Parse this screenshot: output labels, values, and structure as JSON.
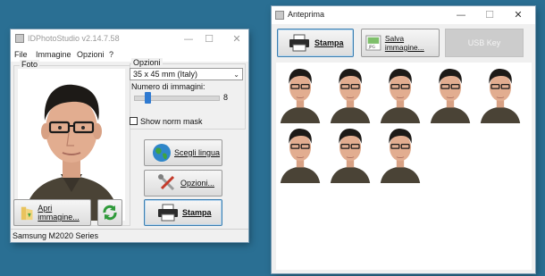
{
  "main_window": {
    "title": "IDPhotoStudio v2.14.7.58",
    "menu": [
      "File",
      "Immagine",
      "Opzioni",
      "?"
    ],
    "photo_group_label": "Foto",
    "options_group_label": "Opzioni",
    "size_select_value": "35 x 45 mm (Italy)",
    "count_label": "Numero di immagini:",
    "count_value": "8",
    "count_slider_fraction": 0.14,
    "norm_mask_label": "Show norm mask",
    "norm_mask_checked": false,
    "language_button": "Scegli lingua",
    "options_button": "Opzioni...",
    "open_image_button": "Apri immagine...",
    "print_button": "Stampa",
    "status_text": "Samsung M2020 Series"
  },
  "preview_window": {
    "title": "Anteprima",
    "print_button": "Stampa",
    "save_button": "Salva immagine...",
    "usb_button": "USB Key",
    "thumbnail_count": 8
  },
  "colors": {
    "desktop": "#2a6f93",
    "accent_border": "#3c7fb1",
    "disabled_button": "#cccccc"
  }
}
